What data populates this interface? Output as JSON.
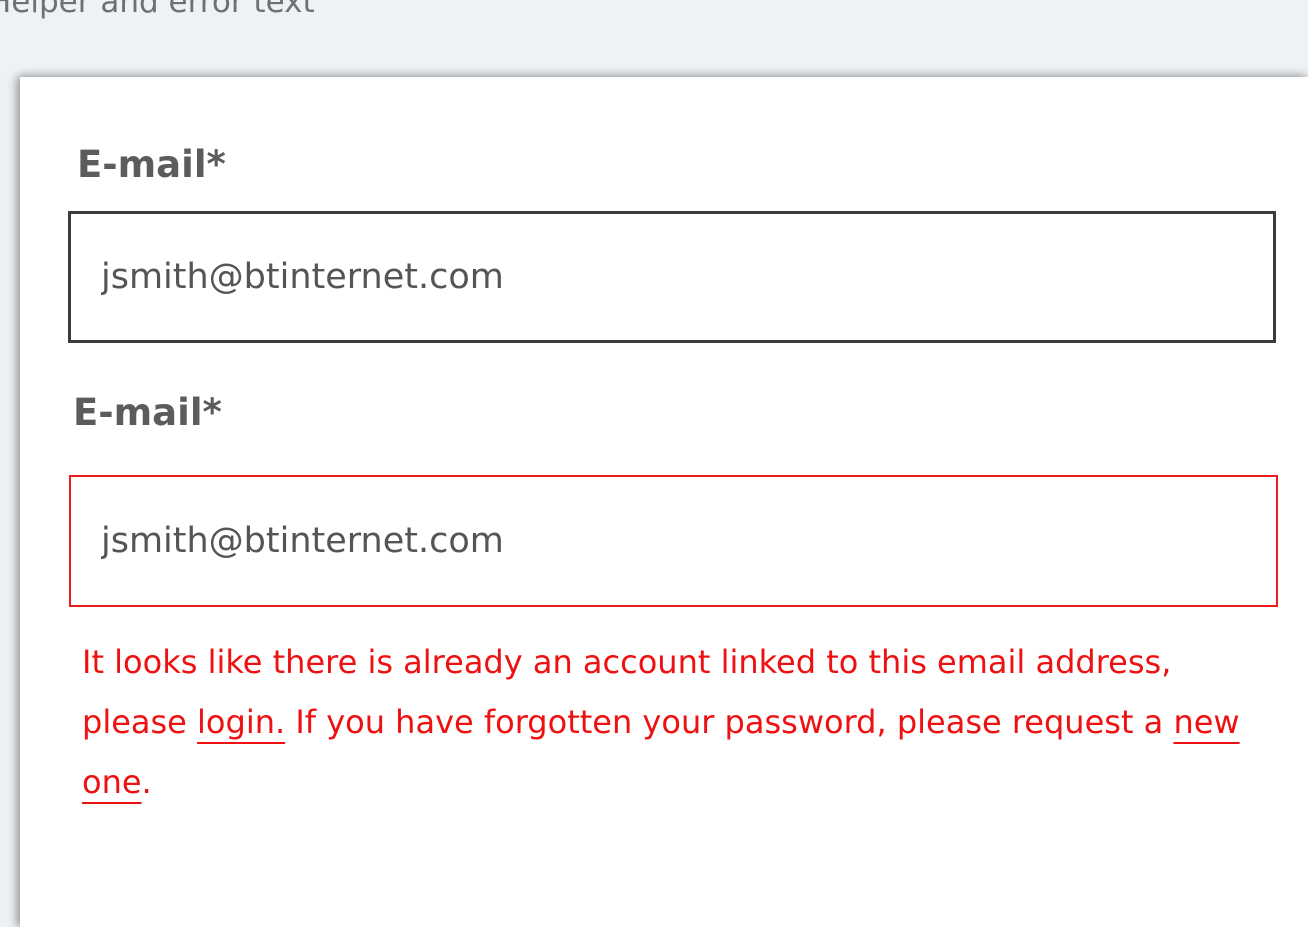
{
  "page": {
    "heading": "Helper and error text"
  },
  "form": {
    "fields": [
      {
        "label": "E-mail*",
        "value": "jsmith@btinternet.com",
        "state": "default"
      },
      {
        "label": "E-mail*",
        "value": "jsmith@btinternet.com",
        "state": "error"
      }
    ],
    "error": {
      "part1": "It looks like there is already an account linked to this email address, please ",
      "login_link": "login.",
      "part2": " If you have forgotten your password, please request a ",
      "new_one_link": "new one",
      "part3": "."
    }
  },
  "colors": {
    "background": "#eef2f5",
    "card": "#ffffff",
    "default_border": "#3b3b3b",
    "error": "#ee1111",
    "label": "#5c5c5c"
  }
}
